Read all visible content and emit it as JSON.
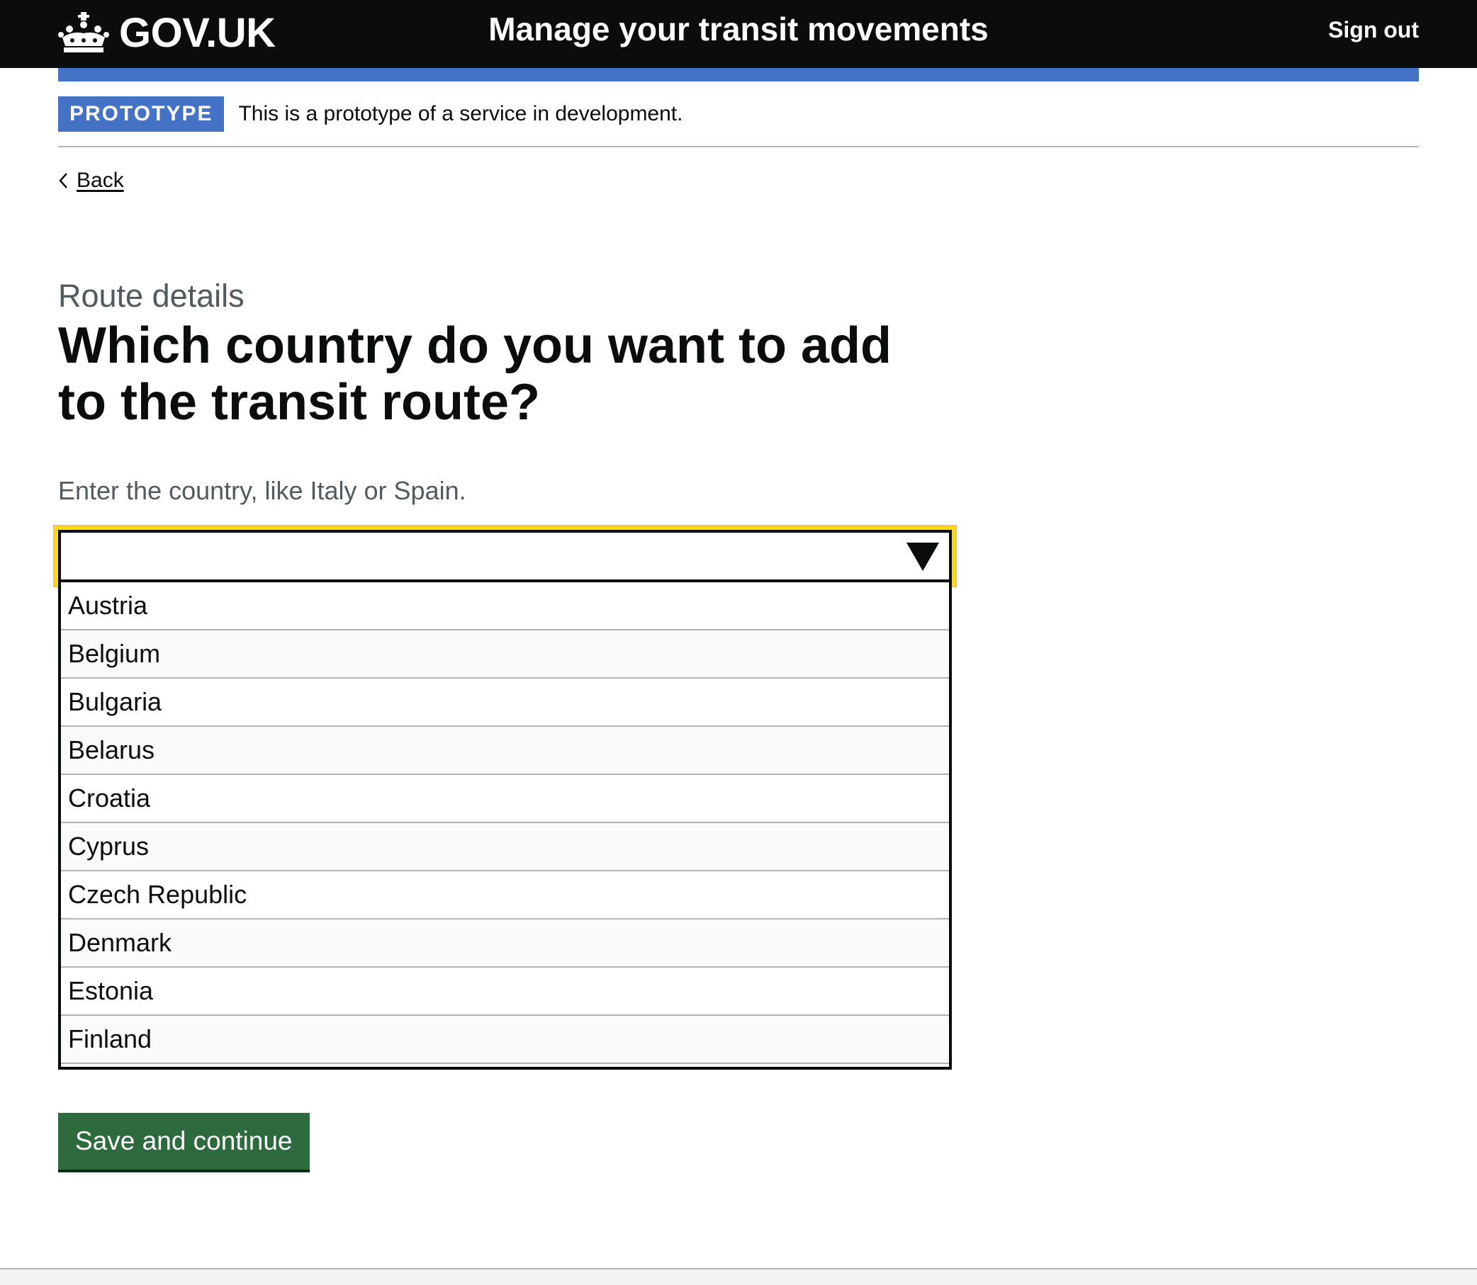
{
  "header": {
    "logo_text": "GOV.UK",
    "service_name": "Manage your transit movements",
    "signout_label": "Sign out"
  },
  "phase_banner": {
    "tag": "PROTOTYPE",
    "text": "This is a prototype of a service in development."
  },
  "back_link": "Back",
  "page": {
    "caption": "Route details",
    "heading": "Which country do you want to add to the transit route?",
    "hint": "Enter the country, like Italy or Spain."
  },
  "combobox": {
    "value": "",
    "options": [
      "Austria",
      "Belgium",
      "Bulgaria",
      "Belarus",
      "Croatia",
      "Cyprus",
      "Czech Republic",
      "Denmark",
      "Estonia",
      "Finland"
    ]
  },
  "submit_label": "Save and continue",
  "colors": {
    "header_bg": "#0b0c0c",
    "accent_blue": "#4472c4",
    "button_green": "#2d6a3e",
    "focus_yellow": "#ffdd00"
  }
}
